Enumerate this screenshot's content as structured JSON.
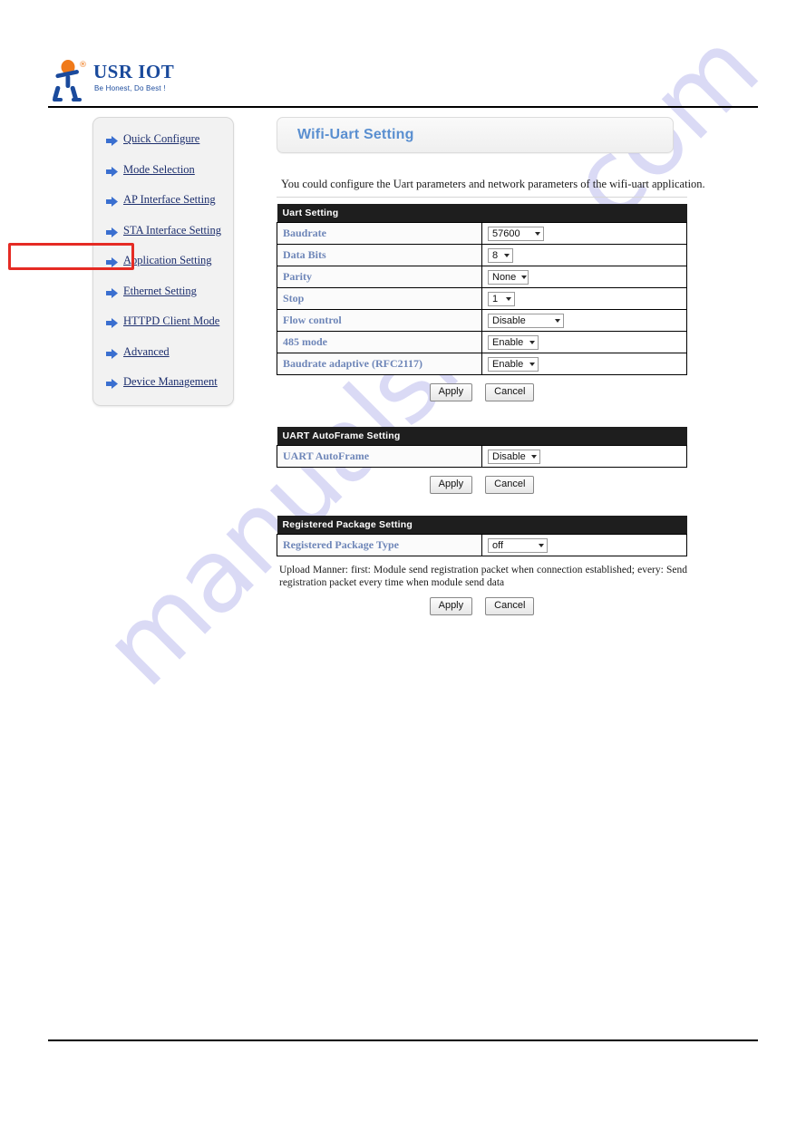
{
  "brand": {
    "name": "USR IOT",
    "tagline": "Be Honest, Do Best !",
    "registered_mark": "®",
    "wordmark_color": "#1a4a9c",
    "mark_accent_color": "#f07a1a"
  },
  "watermark": {
    "text": "manualshive.com",
    "color": "#ccccf2"
  },
  "sidebar": {
    "items": [
      {
        "label": "Quick Configure"
      },
      {
        "label": "Mode Selection"
      },
      {
        "label": "AP Interface Setting"
      },
      {
        "label": "STA Interface Setting"
      },
      {
        "label": "Application Setting"
      },
      {
        "label": "Ethernet Setting"
      },
      {
        "label": "HTTPD Client Mode"
      },
      {
        "label": "Advanced"
      },
      {
        "label": "Device Management"
      }
    ],
    "highlight": {
      "target_label": "Application Setting",
      "color": "#e52b24"
    }
  },
  "main": {
    "panel_title": "Wifi-Uart Setting",
    "panel_title_color": "#5a8fd0",
    "intro": "You could configure the Uart parameters and network parameters of the wifi-uart application.",
    "sections": [
      {
        "heading": "Uart Setting",
        "rows": [
          {
            "label": "Baudrate",
            "value": "57600"
          },
          {
            "label": "Data Bits",
            "value": "8"
          },
          {
            "label": "Parity",
            "value": "None"
          },
          {
            "label": "Stop",
            "value": "1"
          },
          {
            "label": "Flow control",
            "value": "Disable"
          },
          {
            "label": "485 mode",
            "value": "Enable"
          },
          {
            "label": "Baudrate adaptive (RFC2117)",
            "value": "Enable"
          }
        ],
        "apply_label": "Apply",
        "cancel_label": "Cancel"
      },
      {
        "heading": "UART AutoFrame Setting",
        "rows": [
          {
            "label": "UART AutoFrame",
            "value": "Disable"
          }
        ],
        "apply_label": "Apply",
        "cancel_label": "Cancel"
      },
      {
        "heading": "Registered Package Setting",
        "rows": [
          {
            "label": "Registered Package Type",
            "value": "off"
          }
        ],
        "note": "Upload Manner: first: Module send registration packet when connection established; every: Send registration packet every time when module send data",
        "apply_label": "Apply",
        "cancel_label": "Cancel"
      }
    ]
  }
}
